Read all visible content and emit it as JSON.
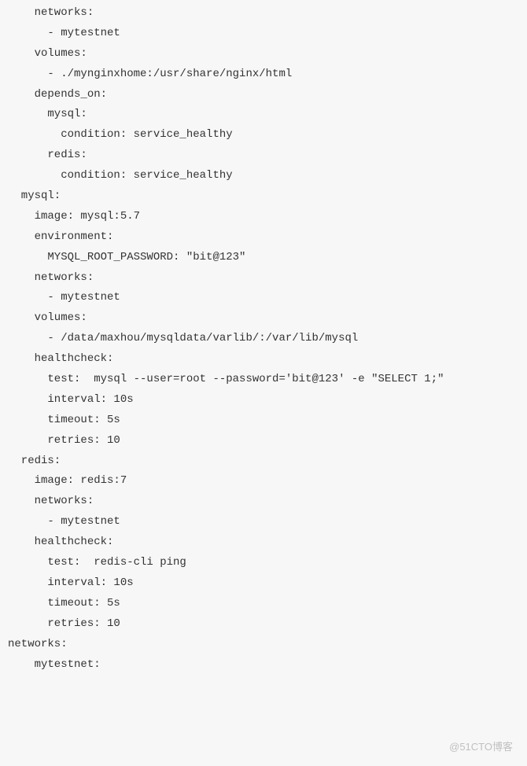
{
  "code_lines": [
    "    networks:",
    "      - mytestnet",
    "    volumes:",
    "      - ./mynginxhome:/usr/share/nginx/html",
    "    depends_on:",
    "      mysql:",
    "        condition: service_healthy",
    "      redis:",
    "        condition: service_healthy",
    "  mysql:",
    "    image: mysql:5.7",
    "    environment:",
    "      MYSQL_ROOT_PASSWORD: \"bit@123\"",
    "    networks:",
    "      - mytestnet",
    "    volumes:",
    "      - /data/maxhou/mysqldata/varlib/:/var/lib/mysql",
    "    healthcheck:",
    "      test:  mysql --user=root --password='bit@123' -e \"SELECT 1;\"",
    "      interval: 10s",
    "      timeout: 5s",
    "      retries: 10",
    "  redis:",
    "    image: redis:7",
    "    networks:",
    "      - mytestnet",
    "    healthcheck:",
    "      test:  redis-cli ping",
    "      interval: 10s",
    "      timeout: 5s",
    "      retries: 10",
    "networks:",
    "    mytestnet:"
  ],
  "watermark": "@51CTO博客"
}
